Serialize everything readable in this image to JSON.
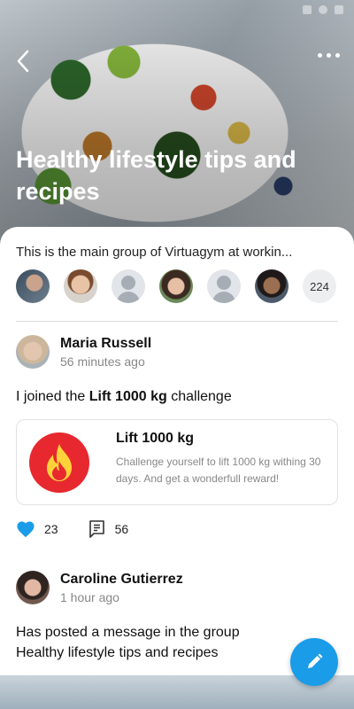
{
  "header": {
    "title": "Healthy lifestyle tips and recipes",
    "back_icon": "chevron-left-icon",
    "more_icon": "more-horizontal-icon"
  },
  "group": {
    "description": "This is the main group of Virtuagym at workin...",
    "member_count": "224"
  },
  "posts": [
    {
      "author": "Maria Russell",
      "time": "56 minutes ago",
      "text_prefix": "I joined the ",
      "text_bold": "Lift 1000 kg",
      "text_suffix": " challenge",
      "card": {
        "title": "Lift 1000 kg",
        "description": "Challenge yourself to lift 1000 kg withing 30 days. And get a wonderfull reward!",
        "icon": "fire-icon"
      },
      "likes": "23",
      "comments": "56"
    },
    {
      "author": "Caroline Gutierrez",
      "time": "1 hour ago",
      "text_line1": "Has posted a message in the group",
      "text_line2": "Healthy lifestyle tips and recipes"
    }
  ],
  "colors": {
    "accent": "#1a9ce8",
    "challenge": "#e8282f"
  }
}
